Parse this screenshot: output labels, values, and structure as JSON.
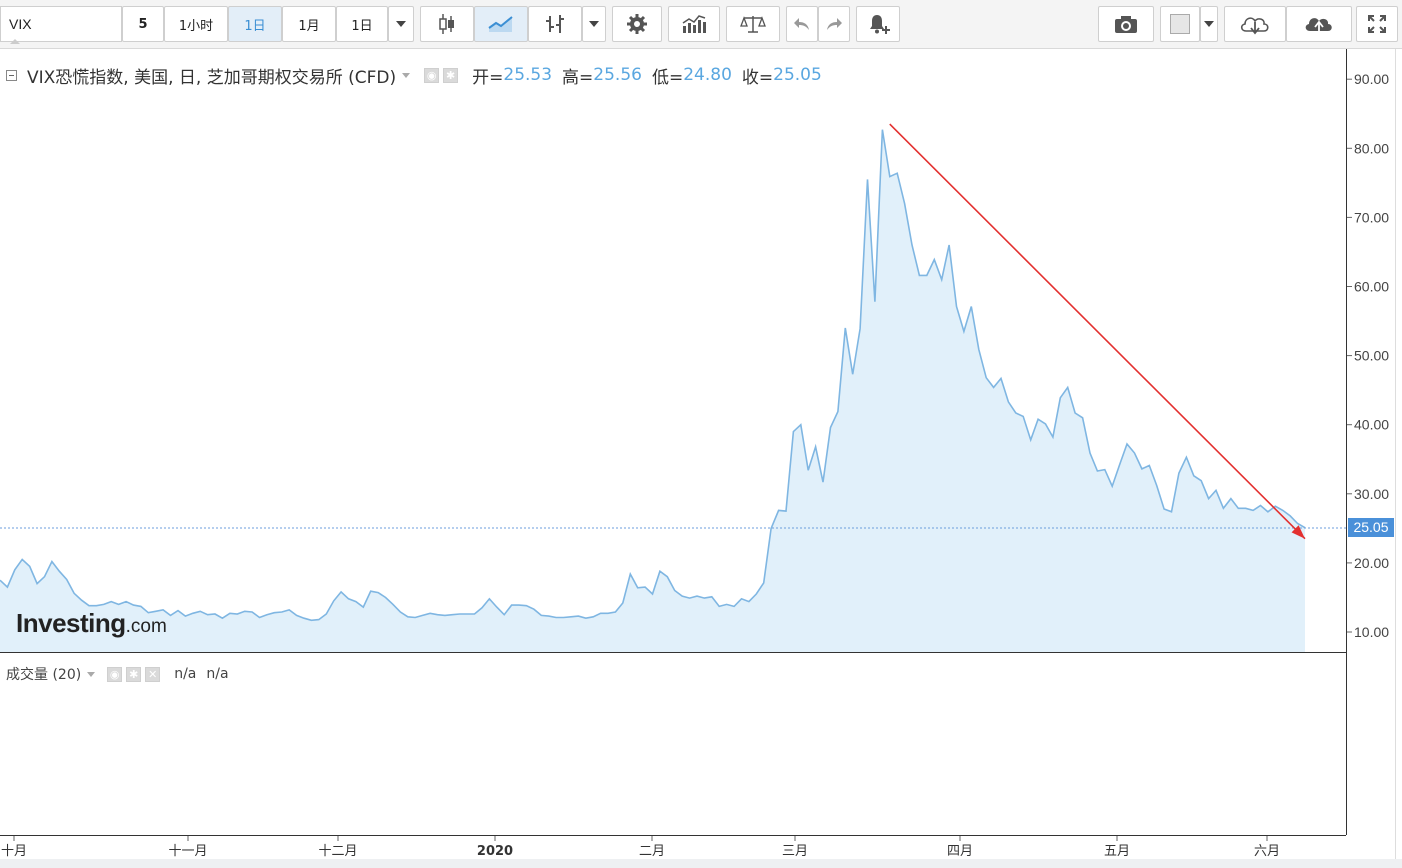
{
  "toolbar": {
    "symbol": "VIX",
    "interval_num": "5",
    "timeframes": [
      "1小时",
      "1日",
      "1月",
      "1日"
    ],
    "active_timeframe": "1日"
  },
  "legend": {
    "title": "VIX恐慌指数, 美国, 日, 芝加哥期权交易所 (CFD)",
    "open_label": "开=",
    "open": "25.53",
    "high_label": "高=",
    "high": "25.56",
    "low_label": "低=",
    "low": "24.80",
    "close_label": "收=",
    "close": "25.05"
  },
  "volume": {
    "title": "成交量 (20)",
    "value1": "n/a",
    "value2": "n/a"
  },
  "brand": {
    "name": "Investing",
    "suffix": ".com"
  },
  "price_tag": "25.05",
  "colors": {
    "line": "#7fb6e2",
    "area": "#e1f0fa",
    "trend_arrow": "#e3302f",
    "price_tag": "#4a90d9",
    "active_tab": "#3b8fd4"
  },
  "chart_data": {
    "type": "area",
    "title": "",
    "xlabel": "",
    "ylabel": "",
    "ylim": [
      7,
      95
    ],
    "yticks": [
      "90.00",
      "80.00",
      "70.00",
      "60.00",
      "50.00",
      "40.00",
      "30.00",
      "20.00",
      "10.00"
    ],
    "xticks": [
      "十月",
      "十一月",
      "十二月",
      "2020",
      "二月",
      "三月",
      "四月",
      "五月",
      "六月"
    ],
    "last_value": 25.05,
    "series": [
      {
        "values": [
          17.5,
          16.5,
          19,
          20.5,
          19.5,
          17,
          18,
          20.2,
          18.8,
          17.6,
          15.6,
          14.6,
          13.8,
          13.8,
          14,
          14.4,
          14,
          14.4,
          13.9,
          13.7,
          12.8,
          13,
          13.2,
          12.4,
          13.1,
          12.3,
          12.7,
          13,
          12.5,
          12.6,
          12,
          12.7,
          12.6,
          13,
          12.9,
          12.1,
          12.5,
          12.8,
          12.9,
          13.2,
          12.4,
          12,
          11.7,
          11.8,
          12.6,
          14.5,
          15.8,
          14.8,
          14.4,
          13.6,
          15.9,
          15.7,
          15,
          14,
          12.9,
          12.2,
          12.1,
          12.4,
          12.7,
          12.5,
          12.4,
          12.5,
          12.6,
          12.6,
          12.6,
          13.5,
          14.8,
          13.6,
          12.5,
          13.9,
          13.9,
          13.8,
          13.3,
          12.4,
          12.3,
          12.1,
          12.1,
          12.2,
          12.3,
          12,
          12.2,
          12.7,
          12.7,
          12.9,
          14.2,
          18.4,
          16.4,
          16.5,
          15.5,
          18.8,
          18,
          16,
          15.2,
          14.9,
          15.2,
          14.9,
          15.1,
          13.7,
          14,
          13.7,
          14.8,
          14.4,
          15.5,
          17.1,
          25,
          27.6,
          27.5,
          39,
          40,
          33.4,
          36.8,
          31.7,
          39.6,
          41.9,
          54,
          47.3,
          53.9,
          75.5,
          57.8,
          82.7,
          75.9,
          76.4,
          72,
          66,
          61.6,
          61.6,
          63.9,
          61,
          66,
          57.1,
          53.5,
          57.1,
          50.9,
          46.8,
          45.4,
          46.7,
          43.3,
          41.7,
          41.2,
          37.8,
          40.8,
          40.1,
          38.2,
          43.9,
          45.4,
          41.7,
          41,
          35.9,
          33.3,
          33.5,
          31.1,
          34.2,
          37.2,
          35.9,
          33.6,
          34.1,
          31.2,
          27.8,
          27.4,
          33,
          35.3,
          32.6,
          31.9,
          29.3,
          30.5,
          27.9,
          29.3,
          27.9,
          27.9,
          27.6,
          28.3,
          27.4,
          28.2,
          27.6,
          26.8,
          25.7,
          25.1
        ]
      }
    ],
    "trendline": {
      "from_index": 120,
      "from_value": 83.5,
      "to_value": 23.5
    }
  }
}
